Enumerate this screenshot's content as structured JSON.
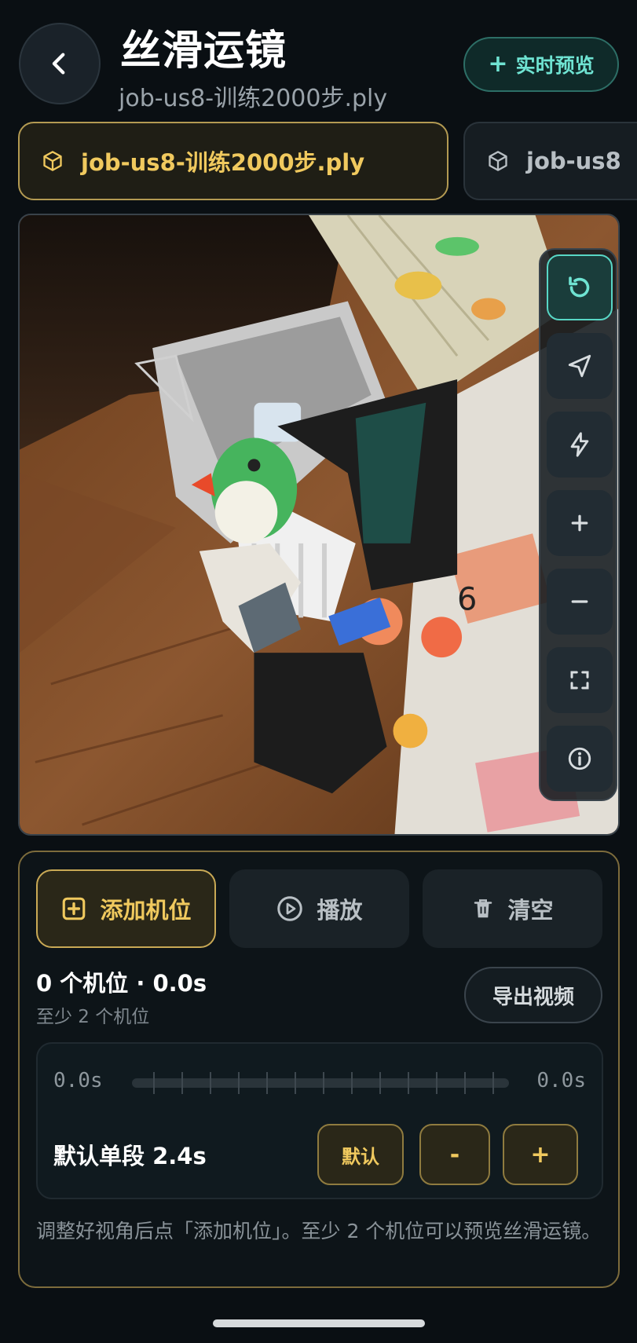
{
  "header": {
    "title": "丝滑运镜",
    "subtitle": "job-us8-训练2000步.ply",
    "live_preview_label": "实时预览"
  },
  "file_tabs": [
    {
      "label": "job-us8-训练2000步.ply",
      "active": true
    },
    {
      "label": "job-us8",
      "active": false
    }
  ],
  "viewer": {
    "tools": [
      "reset-view-icon",
      "send-icon",
      "flash-icon",
      "zoom-in-icon",
      "zoom-out-icon",
      "fullscreen-icon",
      "info-icon"
    ]
  },
  "panel": {
    "add_label": "添加机位",
    "play_label": "播放",
    "clear_label": "清空",
    "count_text": "0 个机位 · 0.0s",
    "min_hint": "至少 2 个机位",
    "export_label": "导出视频",
    "timeline": {
      "start": "0.0s",
      "end": "0.0s",
      "segment_label": "默认单段 2.4s",
      "default_label": "默认",
      "minus_label": "-",
      "plus_label": "+"
    },
    "help": "调整好视角后点「添加机位」。至少 2 个机位可以预览丝滑运镜。"
  },
  "colors": {
    "accent_gold": "#f0c95e",
    "accent_teal": "#6fe3d2",
    "background": "#0a0f13"
  }
}
